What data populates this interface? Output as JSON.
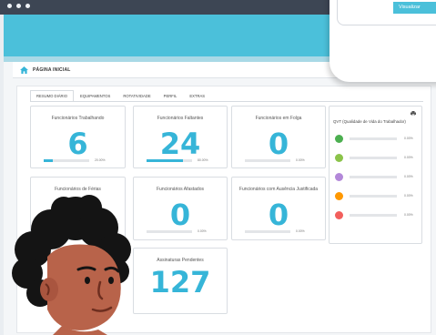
{
  "breadcrumb": {
    "title": "PÁGINA INICIAL"
  },
  "tabs": [
    "RESUMO DIÁRIO",
    "EQUIPAMENTOS",
    "ROTATIVIDADE",
    "PERFIL",
    "EXTRAS"
  ],
  "cards": [
    {
      "title": "Funcionários Trabalhando",
      "value": "6",
      "pct": "20.00%",
      "fill": 0.2
    },
    {
      "title": "Funcionários Faltantes",
      "value": "24",
      "pct": "80.00%",
      "fill": 0.8
    },
    {
      "title": "Funcionários em Folga",
      "value": "0",
      "pct": "0.00%",
      "fill": 0
    },
    {
      "title": "Funcionários de Férias",
      "value": "0",
      "pct": "",
      "fill": 0
    },
    {
      "title": "Funcionários Afastados",
      "value": "0",
      "pct": "0.00%",
      "fill": 0
    },
    {
      "title": "Funcionários com Ausência Justificada",
      "value": "0",
      "pct": "0.00%",
      "fill": 0
    },
    {
      "title": "Assinaturas Pendentes",
      "value": "127",
      "pct": "",
      "fill": 0
    }
  ],
  "qvt": {
    "title": "QVT (Qualidade de Vida do Trabalhador)",
    "rows": [
      {
        "color": "#4caf50",
        "value": "0.00%"
      },
      {
        "color": "#8bc34a",
        "value": "0.00%"
      },
      {
        "color": "#b388d9",
        "value": "0.00%"
      },
      {
        "color": "#ff9800",
        "value": "0.00%"
      },
      {
        "color": "#f25f5c",
        "value": "0.00%"
      }
    ]
  },
  "header_button": {
    "label": "Visualizar"
  },
  "colors": {
    "accent": "#36b5d8",
    "topbar": "#4bc0da"
  }
}
